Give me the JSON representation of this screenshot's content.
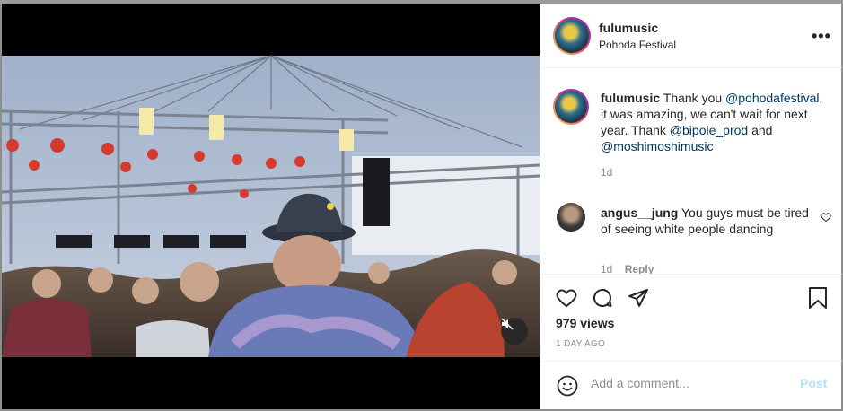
{
  "post": {
    "author": "fulumusic",
    "location": "Pohoda Festival",
    "more_label": "•••"
  },
  "caption": {
    "author": "fulumusic",
    "text_1": "Thank you ",
    "mention_1": "@pohodafestival",
    "text_2": ", it was amazing, we can't wait for next year. Thank ",
    "mention_2": "@bipole_prod",
    "text_3": " and ",
    "mention_3": "@moshimoshimusic",
    "time": "1d"
  },
  "comment": {
    "author": "angus__jung",
    "text": "You guys must be tired of seeing white people dancing",
    "time": "1d",
    "reply_label": "Reply"
  },
  "stats": {
    "views": "979 views",
    "time_ago": "1 DAY AGO"
  },
  "composer": {
    "placeholder": "Add a comment...",
    "post_label": "Post"
  },
  "icons": [
    "more-icon",
    "like-icon",
    "comment-icon",
    "share-icon",
    "save-icon",
    "emoji-icon",
    "mute-icon",
    "comment-like-icon"
  ],
  "colors": {
    "link": "#00376b",
    "post_button": "#b2dffc",
    "muted": "#8e8e8e"
  }
}
